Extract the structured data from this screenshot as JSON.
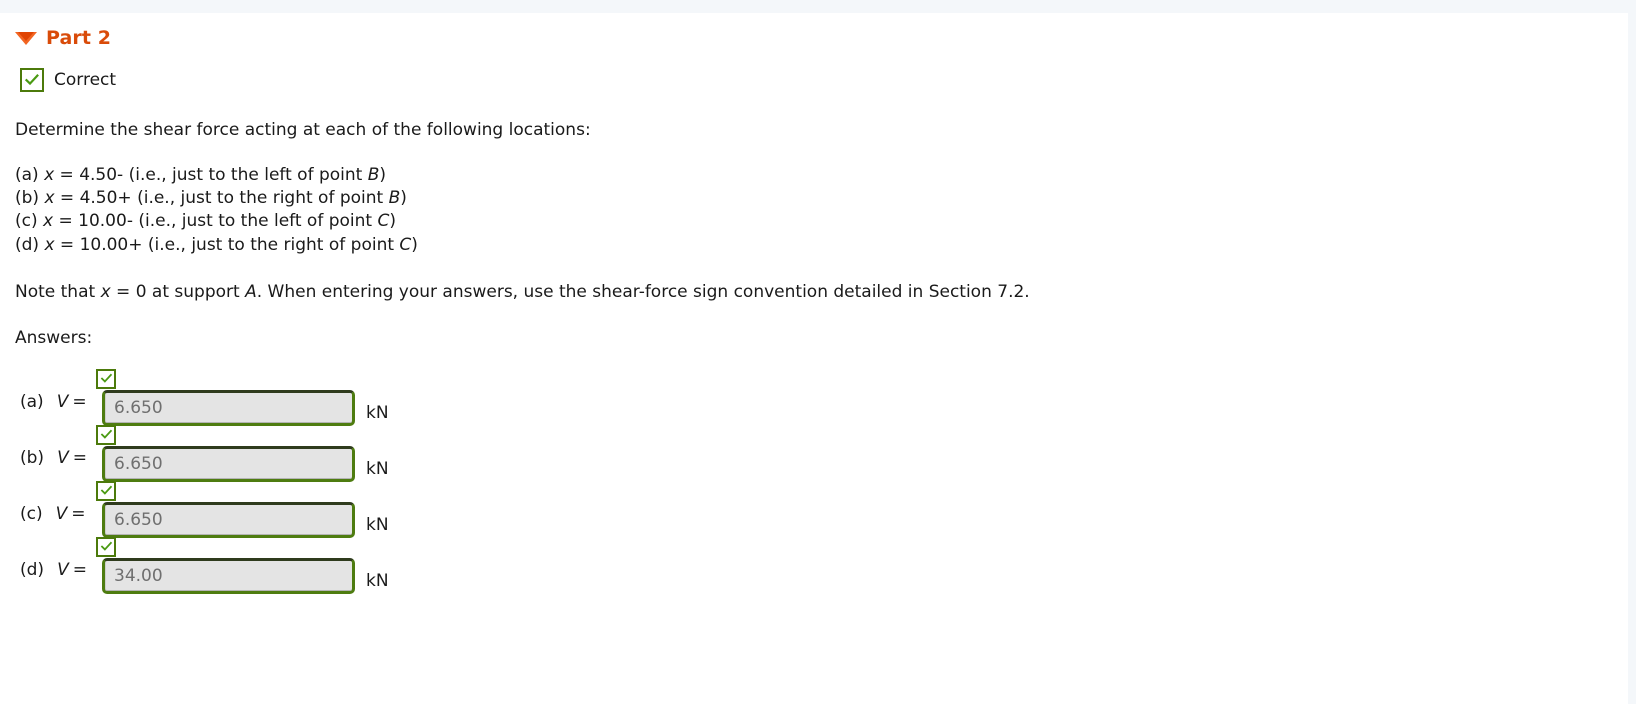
{
  "part": {
    "title": "Part 2",
    "disclosure_icon": "triangle-down-icon",
    "accent_color": "#d94b09"
  },
  "status": {
    "icon": "checkmark-icon",
    "label": "Correct",
    "color": "#4c7a0b"
  },
  "prompt": "Determine the shear force acting at each of the following locations:",
  "locations": [
    {
      "tag": "(a)",
      "pre": "x",
      "expr": " = 4.50- (i.e., just to the left of point ",
      "point": "B",
      "post": ")"
    },
    {
      "tag": "(b)",
      "pre": "x",
      "expr": " = 4.50+ (i.e., just to the right of point ",
      "point": "B",
      "post": ")"
    },
    {
      "tag": "(c)",
      "pre": "x",
      "expr": " = 10.00- (i.e., just to the left of point ",
      "point": "C",
      "post": ")"
    },
    {
      "tag": "(d)",
      "pre": "x",
      "expr": " = 10.00+ (i.e., just to the right of point ",
      "point": "C",
      "post": ")"
    }
  ],
  "note": {
    "seg1": "Note that ",
    "var1": "x",
    "seg2": " = 0 at support ",
    "var2": "A",
    "seg3": ". When entering your answers, use the shear-force sign convention detailed in Section 7.2."
  },
  "answers_label": "Answers:",
  "answers": [
    {
      "tag": "(a)",
      "symbol": "V",
      "equals": "=",
      "value": "6.650",
      "unit": "kN",
      "status_icon": "checkmark-icon"
    },
    {
      "tag": "(b)",
      "symbol": "V",
      "equals": "=",
      "value": "6.650",
      "unit": "kN",
      "status_icon": "checkmark-icon"
    },
    {
      "tag": "(c)",
      "symbol": "V",
      "equals": "=",
      "value": "6.650",
      "unit": "kN",
      "status_icon": "checkmark-icon"
    },
    {
      "tag": "(d)",
      "symbol": "V",
      "equals": "=",
      "value": "34.00",
      "unit": "kN",
      "status_icon": "checkmark-icon"
    }
  ]
}
